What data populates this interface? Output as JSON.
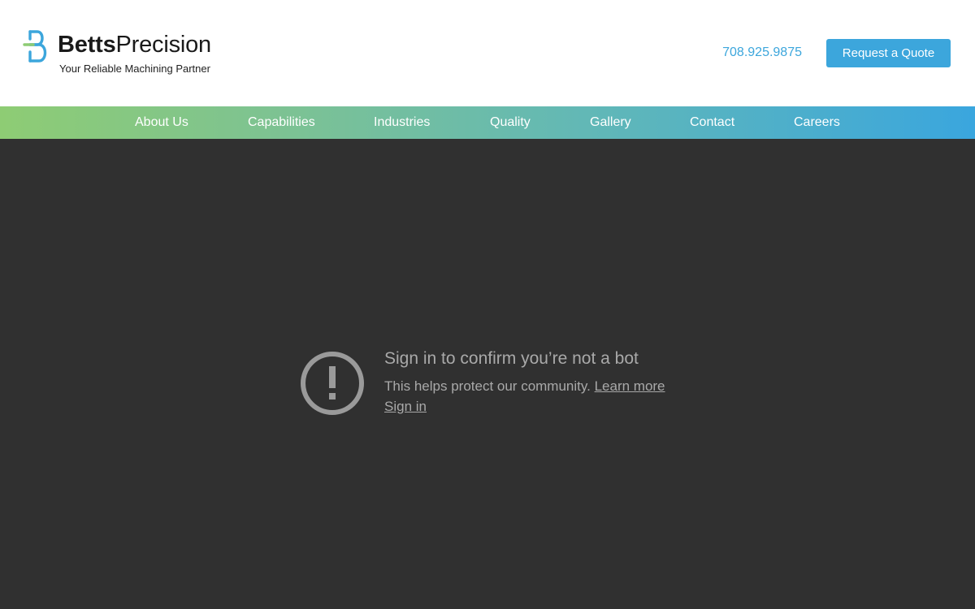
{
  "header": {
    "logo": {
      "name_bold": "Betts",
      "name_regular": "Precision",
      "tagline": "Your Reliable Machining Partner",
      "mark_icon": "betts-b-logo-mark-icon",
      "colors": {
        "blue": "#3ca6dc",
        "green": "#8ecc74"
      }
    },
    "phone": "708.925.9875",
    "quote_button_label": "Request a Quote"
  },
  "nav": {
    "items": [
      {
        "label": "About Us"
      },
      {
        "label": "Capabilities"
      },
      {
        "label": "Industries"
      },
      {
        "label": "Quality"
      },
      {
        "label": "Gallery"
      },
      {
        "label": "Contact"
      },
      {
        "label": "Careers"
      }
    ],
    "gradient": [
      "#8ecc74",
      "#3aa6de"
    ]
  },
  "embed": {
    "icon": "exclamation-circle-icon",
    "title": "Sign in to confirm you’re not a bot",
    "body": "This helps protect our community.",
    "learn_more": "Learn more",
    "sign_in": "Sign in",
    "background": "#303030",
    "text_color": "#a9a9a9"
  },
  "colors": {
    "accent": "#3ca6dc"
  }
}
